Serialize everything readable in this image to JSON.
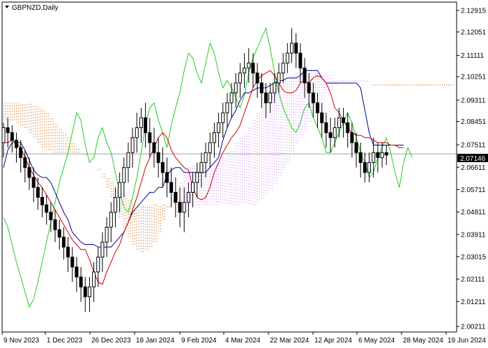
{
  "chart_data": {
    "type": "candlestick",
    "symbol_label": "GBPNZD,Daily",
    "indicator": "Ichimoku Kinko Hyo",
    "current_price": "2.07146",
    "y_ticks": [
      "2.12915",
      "2.12051",
      "2.11111",
      "2.10251",
      "2.09311",
      "2.08451",
      "2.07511",
      "2.06611",
      "2.05711",
      "2.04811",
      "2.03911",
      "2.03015",
      "2.02111",
      "2.01211",
      "2.00211"
    ],
    "x_ticks": [
      "9 Nov 2023",
      "1 Dec 2023",
      "26 Dec 2023",
      "18 Jan 2024",
      "9 Feb 2024",
      "4 Mar 2024",
      "22 Mar 2024",
      "12 Apr 2024",
      "6 May 2024",
      "28 May 2024",
      "19 Jun 2024"
    ],
    "ylim": [
      2.00211,
      2.12915
    ],
    "colors": {
      "tenkan": "#cc0000",
      "kijun": "#00008b",
      "chikou": "#22cc22",
      "kumo_bull": "#d8a0ff",
      "kumo_bear": "#e07a2c",
      "candle": "#000000",
      "price_line": "#a0a0a0",
      "grid": "#e0e0e0"
    },
    "tenkan_sen": [
      2.076,
      2.076,
      2.077,
      2.076,
      2.074,
      2.07,
      2.066,
      2.063,
      2.06,
      2.058,
      2.055,
      2.052,
      2.049,
      2.046,
      2.043,
      2.04,
      2.037,
      2.035,
      2.033,
      2.033,
      2.029,
      2.024,
      2.02,
      2.019,
      2.024,
      2.028,
      2.032,
      2.035,
      2.04,
      2.044,
      2.049,
      2.054,
      2.06,
      2.066,
      2.07,
      2.074,
      2.078,
      2.08,
      2.078,
      2.073,
      2.07,
      2.068,
      2.066,
      2.065,
      2.058,
      2.054,
      2.053,
      2.054,
      2.058,
      2.064,
      2.068,
      2.072,
      2.075,
      2.078,
      2.08,
      2.083,
      2.088,
      2.093,
      2.098,
      2.101,
      2.103,
      2.104,
      2.105,
      2.103,
      2.1,
      2.097,
      2.096,
      2.096,
      2.097,
      2.1,
      2.101,
      2.1,
      2.102,
      2.103,
      2.102,
      2.1,
      2.096,
      2.09,
      2.088,
      2.085,
      2.082,
      2.08,
      2.079,
      2.079,
      2.078,
      2.078,
      2.077,
      2.076,
      2.076,
      2.076,
      2.075,
      2.075,
      2.074,
      2.074
    ],
    "kijun_sen": [
      2.066,
      2.073,
      2.076,
      2.076,
      2.076,
      2.073,
      2.069,
      2.065,
      2.063,
      2.062,
      2.062,
      2.06,
      2.056,
      2.052,
      2.048,
      2.045,
      2.04,
      2.038,
      2.036,
      2.035,
      2.035,
      2.035,
      2.034,
      2.034,
      2.034,
      2.034,
      2.036,
      2.038,
      2.04,
      2.044,
      2.048,
      2.05,
      2.052,
      2.054,
      2.056,
      2.056,
      2.058,
      2.058,
      2.063,
      2.065,
      2.066,
      2.066,
      2.064,
      2.064,
      2.064,
      2.064,
      2.064,
      2.064,
      2.066,
      2.068,
      2.07,
      2.077,
      2.082,
      2.086,
      2.089,
      2.093,
      2.096,
      2.096,
      2.097,
      2.098,
      2.098,
      2.098,
      2.099,
      2.1,
      2.101,
      2.101,
      2.102,
      2.102,
      2.102,
      2.103,
      2.105,
      2.105,
      2.105,
      2.105,
      2.102,
      2.1,
      2.1,
      2.1,
      2.1,
      2.1,
      2.1,
      2.1,
      2.1,
      2.098,
      2.089,
      2.08,
      2.075,
      2.075,
      2.075,
      2.075,
      2.075,
      2.075,
      2.075,
      2.075
    ],
    "senkou_a": [
      2.085,
      2.085,
      2.085,
      2.084,
      2.083,
      2.082,
      2.08,
      2.078,
      2.076,
      2.074,
      2.073,
      2.073,
      2.072,
      2.072,
      2.072,
      2.072,
      2.072,
      2.072,
      2.072,
      2.071,
      2.07,
      2.068,
      2.065,
      2.062,
      2.058,
      2.054,
      2.05,
      2.046,
      2.042,
      2.038,
      2.035,
      2.033,
      2.032,
      2.033,
      2.034,
      2.036,
      2.04,
      2.045,
      2.05,
      2.054,
      2.057,
      2.06,
      2.063,
      2.066,
      2.067,
      2.067,
      2.067,
      2.067,
      2.067,
      2.067,
      2.068,
      2.07,
      2.072,
      2.074,
      2.076,
      2.078,
      2.08,
      2.082,
      2.085,
      2.088,
      2.092,
      2.095,
      2.097,
      2.099,
      2.1,
      2.101,
      2.102,
      2.103,
      2.104,
      2.104,
      2.105,
      2.105,
      2.105,
      2.104,
      2.104,
      2.103,
      2.102,
      2.101,
      2.101,
      2.101,
      2.101,
      2.101,
      2.101,
      2.101,
      2.101,
      2.1,
      2.099,
      2.099,
      2.099,
      2.099,
      2.099,
      2.099,
      2.099,
      2.099,
      2.099,
      2.099,
      2.099,
      2.099,
      2.099,
      2.099,
      2.099,
      2.099,
      2.099,
      2.099,
      2.099,
      2.099
    ],
    "senkou_b": [
      2.092,
      2.092,
      2.092,
      2.092,
      2.092,
      2.092,
      2.092,
      2.091,
      2.09,
      2.089,
      2.088,
      2.086,
      2.084,
      2.082,
      2.08,
      2.078,
      2.076,
      2.074,
      2.072,
      2.072,
      2.07,
      2.068,
      2.066,
      2.064,
      2.062,
      2.06,
      2.058,
      2.056,
      2.055,
      2.053,
      2.052,
      2.051,
      2.051,
      2.051,
      2.051,
      2.051,
      2.051,
      2.051,
      2.051,
      2.051,
      2.051,
      2.051,
      2.051,
      2.05,
      2.05,
      2.05,
      2.051,
      2.051,
      2.051,
      2.051,
      2.051,
      2.051,
      2.051,
      2.051,
      2.051,
      2.051,
      2.051,
      2.051,
      2.051,
      2.052,
      2.053,
      2.055,
      2.057,
      2.059,
      2.062,
      2.065,
      2.068,
      2.072,
      2.075,
      2.078,
      2.081,
      2.084,
      2.087,
      2.09,
      2.093,
      2.095,
      2.097,
      2.099,
      2.1,
      2.1,
      2.1,
      2.1,
      2.1,
      2.1,
      2.1,
      2.1,
      2.1,
      2.1,
      2.1,
      2.1,
      2.1,
      2.1,
      2.1,
      2.1,
      2.1,
      2.1,
      2.1,
      2.1,
      2.1,
      2.1,
      2.1,
      2.1,
      2.1,
      2.1,
      2.1,
      2.1
    ],
    "chikou_span": [
      2.046,
      2.042,
      2.035,
      2.028,
      2.022,
      2.016,
      2.01,
      2.013,
      2.02,
      2.028,
      2.036,
      2.044,
      2.052,
      2.06,
      2.066,
      2.072,
      2.08,
      2.088,
      2.085,
      2.075,
      2.068,
      2.07,
      2.078,
      2.082,
      2.076,
      2.072,
      2.064,
      2.056,
      2.05,
      2.048,
      2.054,
      2.062,
      2.072,
      2.083,
      2.09,
      2.092,
      2.085,
      2.08,
      2.074,
      2.083,
      2.09,
      2.096,
      2.105,
      2.112,
      2.11,
      2.104,
      2.1,
      2.108,
      2.116,
      2.112,
      2.104,
      2.098,
      2.101,
      2.098,
      2.094,
      2.09,
      2.095,
      2.104,
      2.11,
      2.114,
      2.118,
      2.122,
      2.114,
      2.104,
      2.096,
      2.09,
      2.086,
      2.082,
      2.08,
      2.084,
      2.09,
      2.092,
      2.086,
      2.082,
      2.078,
      2.072,
      2.072,
      2.076,
      2.08,
      2.084,
      2.088,
      2.084,
      2.078,
      2.072,
      2.068,
      2.062,
      2.064,
      2.07,
      2.074,
      2.078,
      2.072,
      2.064,
      2.058,
      2.068,
      2.074,
      2.07
    ],
    "candles": [
      [
        2.076,
        2.082,
        2.084,
        2.07
      ],
      [
        2.082,
        2.08,
        2.086,
        2.074
      ],
      [
        2.08,
        2.077,
        2.083,
        2.072
      ],
      [
        2.077,
        2.074,
        2.08,
        2.068
      ],
      [
        2.074,
        2.07,
        2.077,
        2.064
      ],
      [
        2.07,
        2.066,
        2.073,
        2.06
      ],
      [
        2.066,
        2.062,
        2.07,
        2.057
      ],
      [
        2.062,
        2.058,
        2.066,
        2.052
      ],
      [
        2.058,
        2.054,
        2.062,
        2.049
      ],
      [
        2.054,
        2.051,
        2.058,
        2.046
      ],
      [
        2.051,
        2.048,
        2.055,
        2.043
      ],
      [
        2.048,
        2.045,
        2.052,
        2.04
      ],
      [
        2.045,
        2.041,
        2.049,
        2.036
      ],
      [
        2.041,
        2.038,
        2.045,
        2.033
      ],
      [
        2.038,
        2.034,
        2.042,
        2.029
      ],
      [
        2.034,
        2.03,
        2.038,
        2.024
      ],
      [
        2.03,
        2.026,
        2.034,
        2.02
      ],
      [
        2.026,
        2.022,
        2.03,
        2.016
      ],
      [
        2.022,
        2.018,
        2.026,
        2.012
      ],
      [
        2.018,
        2.014,
        2.022,
        2.008
      ],
      [
        2.014,
        2.018,
        2.022,
        2.008
      ],
      [
        2.018,
        2.024,
        2.028,
        2.012
      ],
      [
        2.024,
        2.03,
        2.034,
        2.018
      ],
      [
        2.03,
        2.036,
        2.04,
        2.024
      ],
      [
        2.036,
        2.042,
        2.046,
        2.03
      ],
      [
        2.042,
        2.048,
        2.052,
        2.036
      ],
      [
        2.048,
        2.054,
        2.058,
        2.042
      ],
      [
        2.054,
        2.06,
        2.064,
        2.048
      ],
      [
        2.06,
        2.066,
        2.07,
        2.054
      ],
      [
        2.066,
        2.072,
        2.076,
        2.06
      ],
      [
        2.072,
        2.078,
        2.082,
        2.066
      ],
      [
        2.078,
        2.082,
        2.088,
        2.072
      ],
      [
        2.082,
        2.086,
        2.09,
        2.076
      ],
      [
        2.086,
        2.08,
        2.092,
        2.074
      ],
      [
        2.08,
        2.076,
        2.086,
        2.07
      ],
      [
        2.076,
        2.072,
        2.082,
        2.066
      ],
      [
        2.072,
        2.068,
        2.078,
        2.062
      ],
      [
        2.068,
        2.064,
        2.074,
        2.058
      ],
      [
        2.064,
        2.06,
        2.07,
        2.054
      ],
      [
        2.06,
        2.056,
        2.066,
        2.05
      ],
      [
        2.056,
        2.052,
        2.062,
        2.046
      ],
      [
        2.052,
        2.048,
        2.058,
        2.042
      ],
      [
        2.048,
        2.052,
        2.058,
        2.04
      ],
      [
        2.052,
        2.056,
        2.06,
        2.046
      ],
      [
        2.056,
        2.06,
        2.064,
        2.05
      ],
      [
        2.06,
        2.064,
        2.068,
        2.054
      ],
      [
        2.064,
        2.068,
        2.072,
        2.058
      ],
      [
        2.068,
        2.072,
        2.076,
        2.062
      ],
      [
        2.072,
        2.076,
        2.08,
        2.066
      ],
      [
        2.076,
        2.08,
        2.084,
        2.07
      ],
      [
        2.08,
        2.084,
        2.088,
        2.074
      ],
      [
        2.084,
        2.088,
        2.092,
        2.078
      ],
      [
        2.088,
        2.092,
        2.096,
        2.082
      ],
      [
        2.092,
        2.096,
        2.1,
        2.086
      ],
      [
        2.096,
        2.1,
        2.104,
        2.09
      ],
      [
        2.1,
        2.104,
        2.108,
        2.094
      ],
      [
        2.104,
        2.106,
        2.112,
        2.098
      ],
      [
        2.106,
        2.108,
        2.114,
        2.1
      ],
      [
        2.108,
        2.104,
        2.112,
        2.098
      ],
      [
        2.104,
        2.1,
        2.108,
        2.094
      ],
      [
        2.1,
        2.096,
        2.104,
        2.09
      ],
      [
        2.096,
        2.092,
        2.1,
        2.086
      ],
      [
        2.092,
        2.096,
        2.1,
        2.088
      ],
      [
        2.096,
        2.1,
        2.104,
        2.092
      ],
      [
        2.1,
        2.104,
        2.108,
        2.096
      ],
      [
        2.104,
        2.108,
        2.112,
        2.1
      ],
      [
        2.108,
        2.112,
        2.116,
        2.104
      ],
      [
        2.112,
        2.116,
        2.122,
        2.108
      ],
      [
        2.116,
        2.112,
        2.12,
        2.106
      ],
      [
        2.112,
        2.106,
        2.116,
        2.1
      ],
      [
        2.106,
        2.1,
        2.11,
        2.094
      ],
      [
        2.1,
        2.096,
        2.104,
        2.09
      ],
      [
        2.096,
        2.092,
        2.1,
        2.086
      ],
      [
        2.092,
        2.088,
        2.096,
        2.082
      ],
      [
        2.088,
        2.084,
        2.092,
        2.078
      ],
      [
        2.084,
        2.08,
        2.088,
        2.074
      ],
      [
        2.08,
        2.078,
        2.086,
        2.072
      ],
      [
        2.078,
        2.082,
        2.086,
        2.074
      ],
      [
        2.082,
        2.086,
        2.09,
        2.078
      ],
      [
        2.086,
        2.084,
        2.09,
        2.078
      ],
      [
        2.084,
        2.08,
        2.088,
        2.074
      ],
      [
        2.08,
        2.076,
        2.084,
        2.07
      ],
      [
        2.076,
        2.072,
        2.08,
        2.066
      ],
      [
        2.072,
        2.068,
        2.076,
        2.062
      ],
      [
        2.068,
        2.064,
        2.072,
        2.06
      ],
      [
        2.064,
        2.068,
        2.072,
        2.06
      ],
      [
        2.068,
        2.072,
        2.078,
        2.062
      ],
      [
        2.072,
        2.07,
        2.076,
        2.064
      ],
      [
        2.07,
        2.072,
        2.076,
        2.066
      ],
      [
        2.072,
        2.071,
        2.075,
        2.067
      ]
    ]
  }
}
